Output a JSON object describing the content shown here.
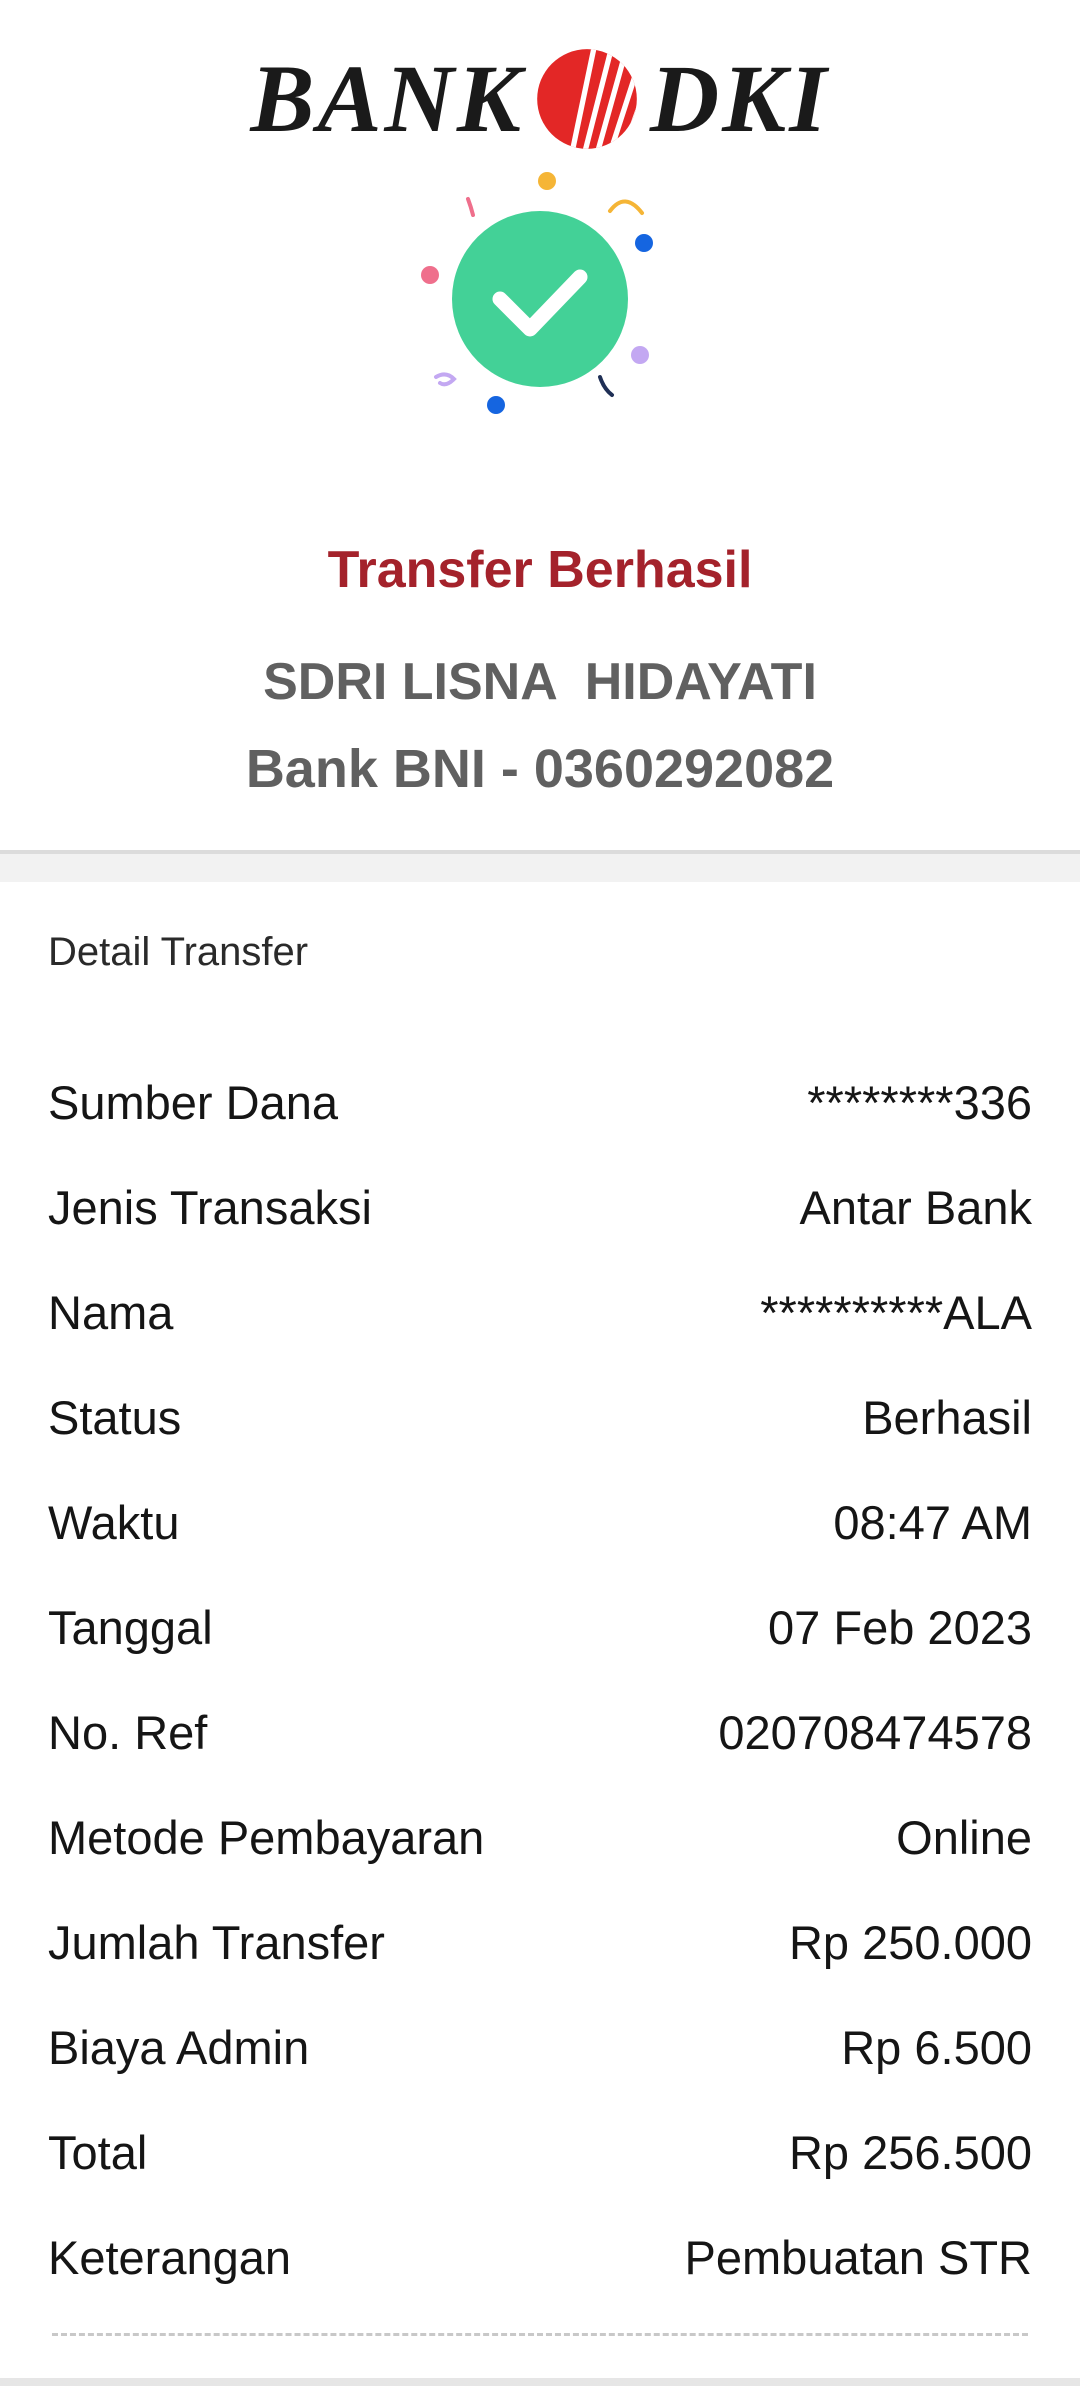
{
  "header": {
    "logo_left": "BANK",
    "logo_right": "DKI"
  },
  "icons": {
    "success": "check-circle-icon",
    "logo_mark": "bank-dki-emblem-icon"
  },
  "colors": {
    "brand_red": "#e32726",
    "title_red": "#a4222b",
    "success_green": "#43d197"
  },
  "summary": {
    "status_title": "Transfer Berhasil",
    "recipient_name": "SDRI LISNA  HIDAYATI",
    "recipient_bank": "Bank BNI - 0360292082"
  },
  "detail": {
    "title": "Detail Transfer",
    "rows": [
      {
        "label": "Sumber Dana",
        "value": "********336"
      },
      {
        "label": "Jenis Transaksi",
        "value": "Antar Bank"
      },
      {
        "label": "Nama",
        "value": "**********ALA"
      },
      {
        "label": "Status",
        "value": "Berhasil"
      },
      {
        "label": "Waktu",
        "value": "08:47 AM"
      },
      {
        "label": "Tanggal",
        "value": "07 Feb 2023"
      },
      {
        "label": "No. Ref",
        "value": "020708474578"
      },
      {
        "label": "Metode Pembayaran",
        "value": "Online"
      },
      {
        "label": "Jumlah Transfer",
        "value": "Rp 250.000"
      },
      {
        "label": "Biaya Admin",
        "value": "Rp 6.500"
      },
      {
        "label": "Total",
        "value": "Rp 256.500"
      },
      {
        "label": "Keterangan",
        "value": "Pembuatan STR"
      }
    ]
  }
}
